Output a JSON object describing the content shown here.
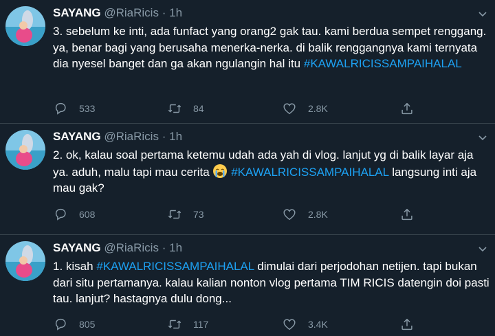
{
  "tweets": [
    {
      "name": "SAYANG",
      "handle": "@RiaRicis",
      "dot": "·",
      "time": "1h",
      "text_before": "3. sebelum ke inti, ada funfact yang orang2 gak tau. kami berdua sempet renggang. ya, benar bagi yang berusaha menerka-nerka. di balik renggangnya kami ternyata dia nyesel banget dan ga akan ngulangin hal itu ",
      "hashtag": "#KAWALRICISSAMPAIHALAL",
      "text_after": "",
      "replies": "533",
      "retweets": "84",
      "likes": "2.8K"
    },
    {
      "name": "SAYANG",
      "handle": "@RiaRicis",
      "dot": "·",
      "time": "1h",
      "text_before": "2. ok, kalau soal pertama ketemu udah ada yah di vlog. lanjut yg di balik layar aja ya. aduh, malu tapi mau cerita ",
      "emoji": "loudly-crying-face",
      "hashtag": "#KAWALRICISSAMPAIHALAL",
      "text_after": " langsung inti aja mau gak?",
      "replies": "608",
      "retweets": "73",
      "likes": "2.8K"
    },
    {
      "name": "SAYANG",
      "handle": "@RiaRicis",
      "dot": "·",
      "time": "1h",
      "text_before": "1. kisah ",
      "hashtag": "#KAWALRICISSAMPAIHALAL",
      "text_after": " dimulai dari perjodohan netijen. tapi bukan dari situ pertamanya. kalau kalian nonton vlog pertama TIM RICIS datengin doi pasti tau. lanjut? hastagnya dulu dong...",
      "replies": "805",
      "retweets": "117",
      "likes": "3.4K"
    }
  ],
  "icons": {
    "reply": "reply-icon",
    "retweet": "retweet-icon",
    "like": "like-icon",
    "share": "share-icon",
    "menu": "chevron-down-icon"
  },
  "colors": {
    "background": "#15202b",
    "text": "#ffffff",
    "muted": "#8899a6",
    "hashtag": "#1da1f2",
    "divider": "#38444d"
  }
}
